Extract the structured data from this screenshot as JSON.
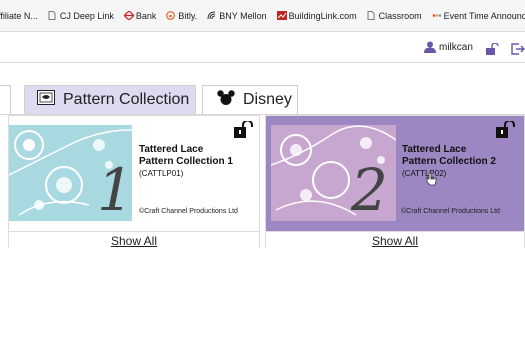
{
  "bookmarks": [
    {
      "label": "ffiliate N...",
      "icon": "link-icon"
    },
    {
      "label": "CJ Deep Link",
      "icon": "page-icon"
    },
    {
      "label": "Bank",
      "icon": "bank-icon",
      "color": "#d0222a"
    },
    {
      "label": "Bitly.",
      "icon": "bitly-icon",
      "color": "#ee6123"
    },
    {
      "label": "BNY Mellon",
      "icon": "bny-icon"
    },
    {
      "label": "BuildingLink.com",
      "icon": "buildinglink-icon",
      "color": "#c0271f"
    },
    {
      "label": "Classroom",
      "icon": "page-icon"
    },
    {
      "label": "Event Time Announcer",
      "icon": "event-icon",
      "color": "#f2a900"
    }
  ],
  "user": {
    "name": "milkcan"
  },
  "tabs": [
    {
      "label": "Pattern Collection",
      "icon": "pattern-icon",
      "active": true
    },
    {
      "label": "Disney",
      "icon": "mickey-icon",
      "active": false
    }
  ],
  "cards": [
    {
      "title_line1": "Tattered Lace",
      "title_line2": "Pattern Collection 1",
      "code": "(CATTLP01)",
      "number": "1",
      "copyright": "©Craft Channel Productions Ltd",
      "show_all": "Show All",
      "thumb_color": "#a9d9e0",
      "highlighted": false
    },
    {
      "title_line1": "Tattered Lace",
      "title_line2": "Pattern Collection 2",
      "code": "(CATTLP02)",
      "number": "2",
      "copyright": "©Craft Channel Productions Ltd",
      "show_all": "Show All",
      "thumb_color": "#c7a7cf",
      "highlighted": true
    }
  ],
  "colors": {
    "active_tab": "#dcdbf0",
    "highlight_panel": "#9c87c3",
    "user_icon": "#6b55a8"
  }
}
